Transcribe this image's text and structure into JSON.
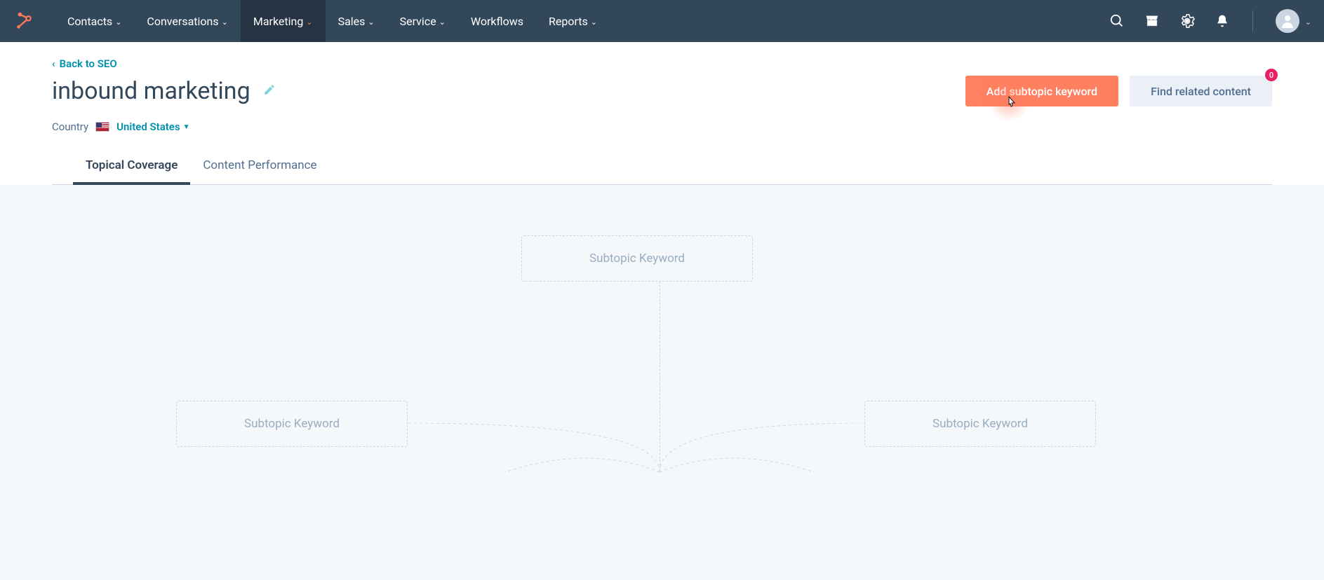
{
  "nav": {
    "items": [
      {
        "label": "Contacts",
        "dropdown": true,
        "active": false
      },
      {
        "label": "Conversations",
        "dropdown": true,
        "active": false
      },
      {
        "label": "Marketing",
        "dropdown": true,
        "active": true
      },
      {
        "label": "Sales",
        "dropdown": true,
        "active": false
      },
      {
        "label": "Service",
        "dropdown": true,
        "active": false
      },
      {
        "label": "Workflows",
        "dropdown": false,
        "active": false
      },
      {
        "label": "Reports",
        "dropdown": true,
        "active": false
      }
    ]
  },
  "header": {
    "back_label": "Back to SEO",
    "title": "inbound marketing",
    "country_label": "Country",
    "country_value": "United States",
    "add_button": "Add subtopic keyword",
    "find_button": "Find related content",
    "badge_count": "0"
  },
  "tabs": [
    {
      "label": "Topical Coverage",
      "active": true
    },
    {
      "label": "Content Performance",
      "active": false
    }
  ],
  "canvas": {
    "placeholder": "Subtopic Keyword"
  }
}
